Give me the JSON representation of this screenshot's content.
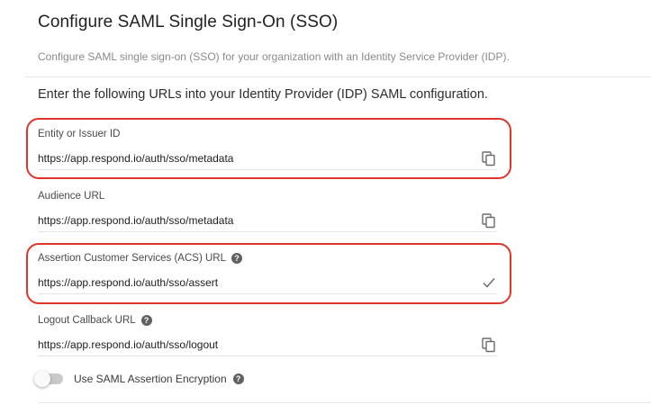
{
  "page": {
    "title": "Configure SAML Single Sign-On (SSO)",
    "subtitle": "Configure SAML single sign-on (SSO) for your organization with an Identity Service Provider (IDP).",
    "intro": "Enter the following URLs into your Identity Provider (IDP) SAML configuration."
  },
  "fields": [
    {
      "label": "Entity or Issuer ID",
      "value": "https://app.respond.io/auth/sso/metadata",
      "action_icon": "copy-icon",
      "has_help": false
    },
    {
      "label": "Audience URL",
      "value": "https://app.respond.io/auth/sso/metadata",
      "action_icon": "copy-icon",
      "has_help": false
    },
    {
      "label": "Assertion Customer Services (ACS) URL",
      "value": "https://app.respond.io/auth/sso/assert",
      "action_icon": "check-icon",
      "has_help": true
    },
    {
      "label": "Logout Callback URL",
      "value": "https://app.respond.io/auth/sso/logout",
      "action_icon": "copy-icon",
      "has_help": true
    }
  ],
  "encryption": {
    "label": "Use SAML Assertion Encryption",
    "enabled": false,
    "has_help": true
  },
  "colors": {
    "highlight": "#e0352b",
    "help_icon": "#616161"
  },
  "help_glyph": "?"
}
